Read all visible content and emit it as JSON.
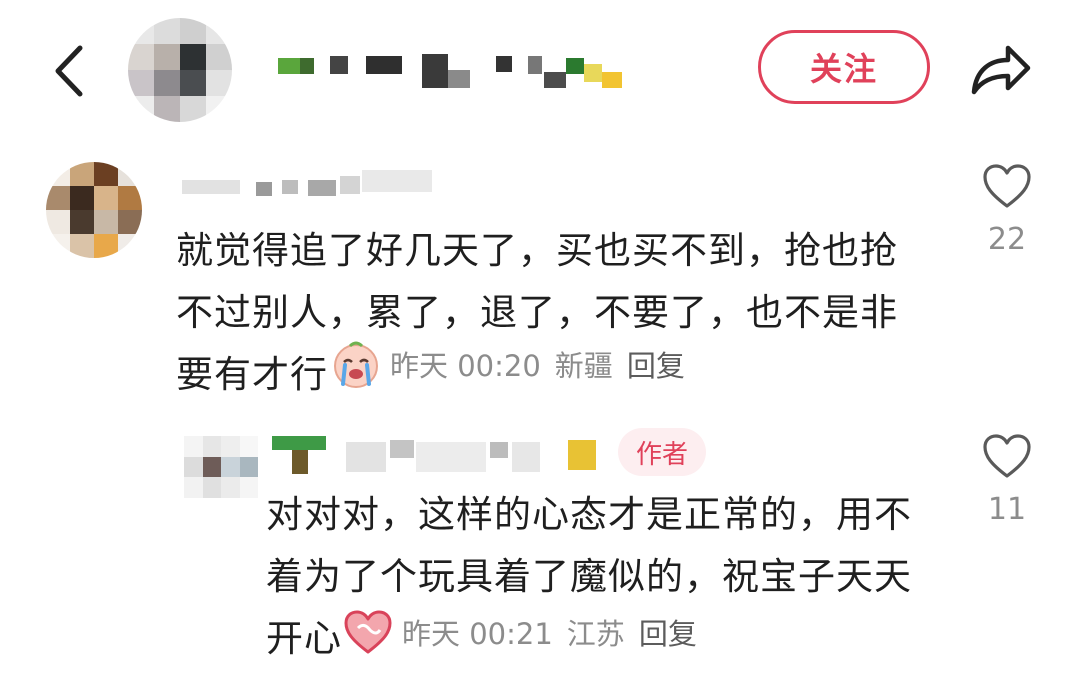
{
  "header": {
    "follow_label": "关注"
  },
  "comment": {
    "line1": "就觉得追了好几天了，买也买不到，抢也抢",
    "line2": "不过别人，累了，退了，不要了，也不是非",
    "line3": "要有才行",
    "emoji": "crying-face-emoji",
    "time": "昨天 00:20",
    "location": "新疆",
    "reply_label": "回复",
    "like_count": "22"
  },
  "reply": {
    "author_badge": "作者",
    "line1": "对对对，这样的心态才是正常的，用不",
    "line2": "着为了个玩具着了魔似的，祝宝子天天",
    "line3": "开心",
    "emoji": "heart-hands-emoji",
    "time": "昨天 00:21",
    "location": "江苏",
    "reply_label": "回复",
    "like_count": "11"
  },
  "colors": {
    "accent": "#e0415a",
    "muted_text": "#8c8c8c",
    "body_text": "#1f1f1f",
    "badge_bg": "#fdeef0"
  }
}
